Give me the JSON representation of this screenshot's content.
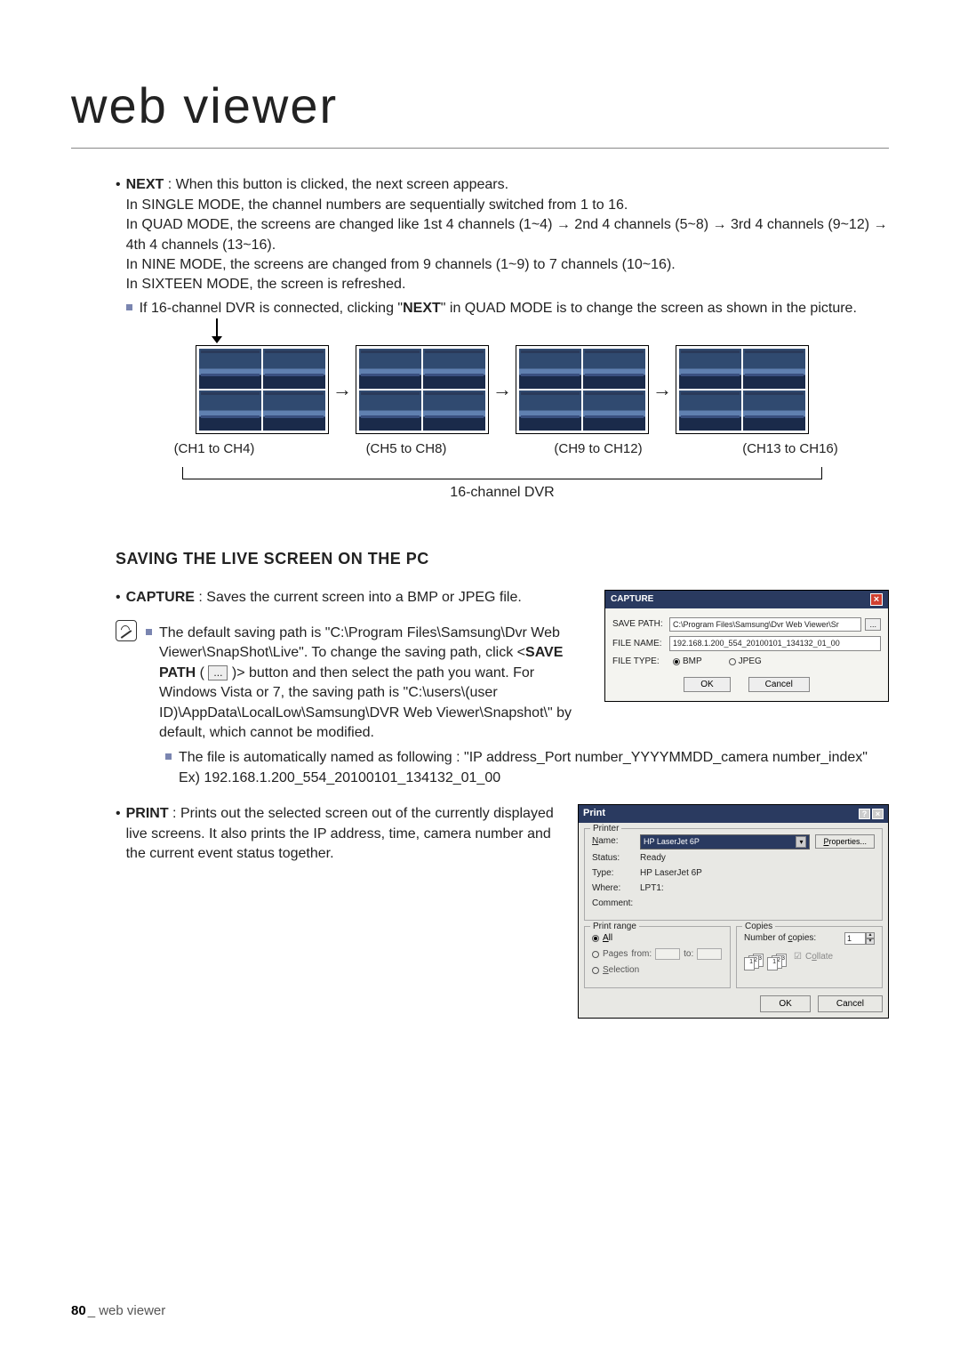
{
  "title": "web viewer",
  "next_section": {
    "label": "NEXT",
    "desc": " : When this button is clicked, the next screen appears.",
    "single": "In SINGLE MODE, the channel numbers are sequentially switched from 1 to 16.",
    "quad": "In QUAD MODE, the screens are changed like 1st 4 channels (1~4) → 2nd 4 channels (5~8) → 3rd 4 channels (9~12) → 4th 4 channels (13~16).",
    "nine": "In NINE MODE, the screens are changed from 9 channels (1~9) to 7 channels (10~16).",
    "sixteen": "In SIXTEEN MODE, the screen is refreshed.",
    "note_prefix": "If 16-channel DVR is connected, clicking \"",
    "note_bold": "NEXT",
    "note_suffix": "\" in QUAD MODE is to change the screen as shown in the picture."
  },
  "flow_labels": [
    "(CH1 to CH4)",
    "(CH5 to CH8)",
    "(CH9 to CH12)",
    "(CH13 to CH16)"
  ],
  "flow_bottom": "16-channel DVR",
  "saving_heading": "SAVING THE LIVE SCREEN ON THE PC",
  "capture": {
    "label": "CAPTURE",
    "desc": " : Saves the current screen into a BMP or JPEG file.",
    "note_a_prefix": "The default saving path is \"C:\\Program Files\\Samsung\\Dvr Web Viewer\\SnapShot\\Live\". To change the saving path, click <",
    "note_a_bold": "SAVE PATH",
    "note_a_mid": " ( ",
    "note_a_suffix": " )> button and then select the path you want. For Windows Vista or 7, the saving path is \"C:\\users\\(user ID)\\AppData\\LocalLow\\Samsung\\DVR Web Viewer\\Snapshot\\\" by default, which cannot be modified.",
    "note_b": "The file is automatically named as following : \"IP address_Port number_YYYYMMDD_camera number_index\"",
    "note_b_ex": "Ex) 192.168.1.200_554_20100101_134132_01_00"
  },
  "capture_dialog": {
    "title": "CAPTURE",
    "save_path_label": "SAVE PATH:",
    "save_path_value": "C:\\Program Files\\Samsung\\Dvr Web Viewer\\Sr",
    "browse": "...",
    "file_name_label": "FILE NAME:",
    "file_name_value": "192.168.1.200_554_20100101_134132_01_00",
    "file_type_label": "FILE TYPE:",
    "type_bmp": "BMP",
    "type_jpeg": "JPEG",
    "ok": "OK",
    "cancel": "Cancel"
  },
  "print": {
    "label": "PRINT",
    "desc": " : Prints out the selected screen out of the currently displayed live screens. It also prints the IP address, time, camera number and the current event status together."
  },
  "print_dialog": {
    "title": "Print",
    "printer_legend": "Printer",
    "name_label": "Name:",
    "name_value": "HP LaserJet 6P",
    "properties": "Properties...",
    "status_label": "Status:",
    "status_value": "Ready",
    "type_label": "Type:",
    "type_value": "HP LaserJet 6P",
    "where_label": "Where:",
    "where_value": "LPT1:",
    "comment_label": "Comment:",
    "range_legend": "Print range",
    "all": "All",
    "pages": "Pages",
    "from": "from:",
    "to": "to:",
    "selection": "Selection",
    "copies_legend": "Copies",
    "copies_label": "Number of copies:",
    "copies_value": "1",
    "collate": "Collate",
    "ok": "OK",
    "cancel": "Cancel"
  },
  "footer": {
    "page": "80",
    "sep": "_ ",
    "text": "web viewer"
  },
  "path_btn_label": "..."
}
